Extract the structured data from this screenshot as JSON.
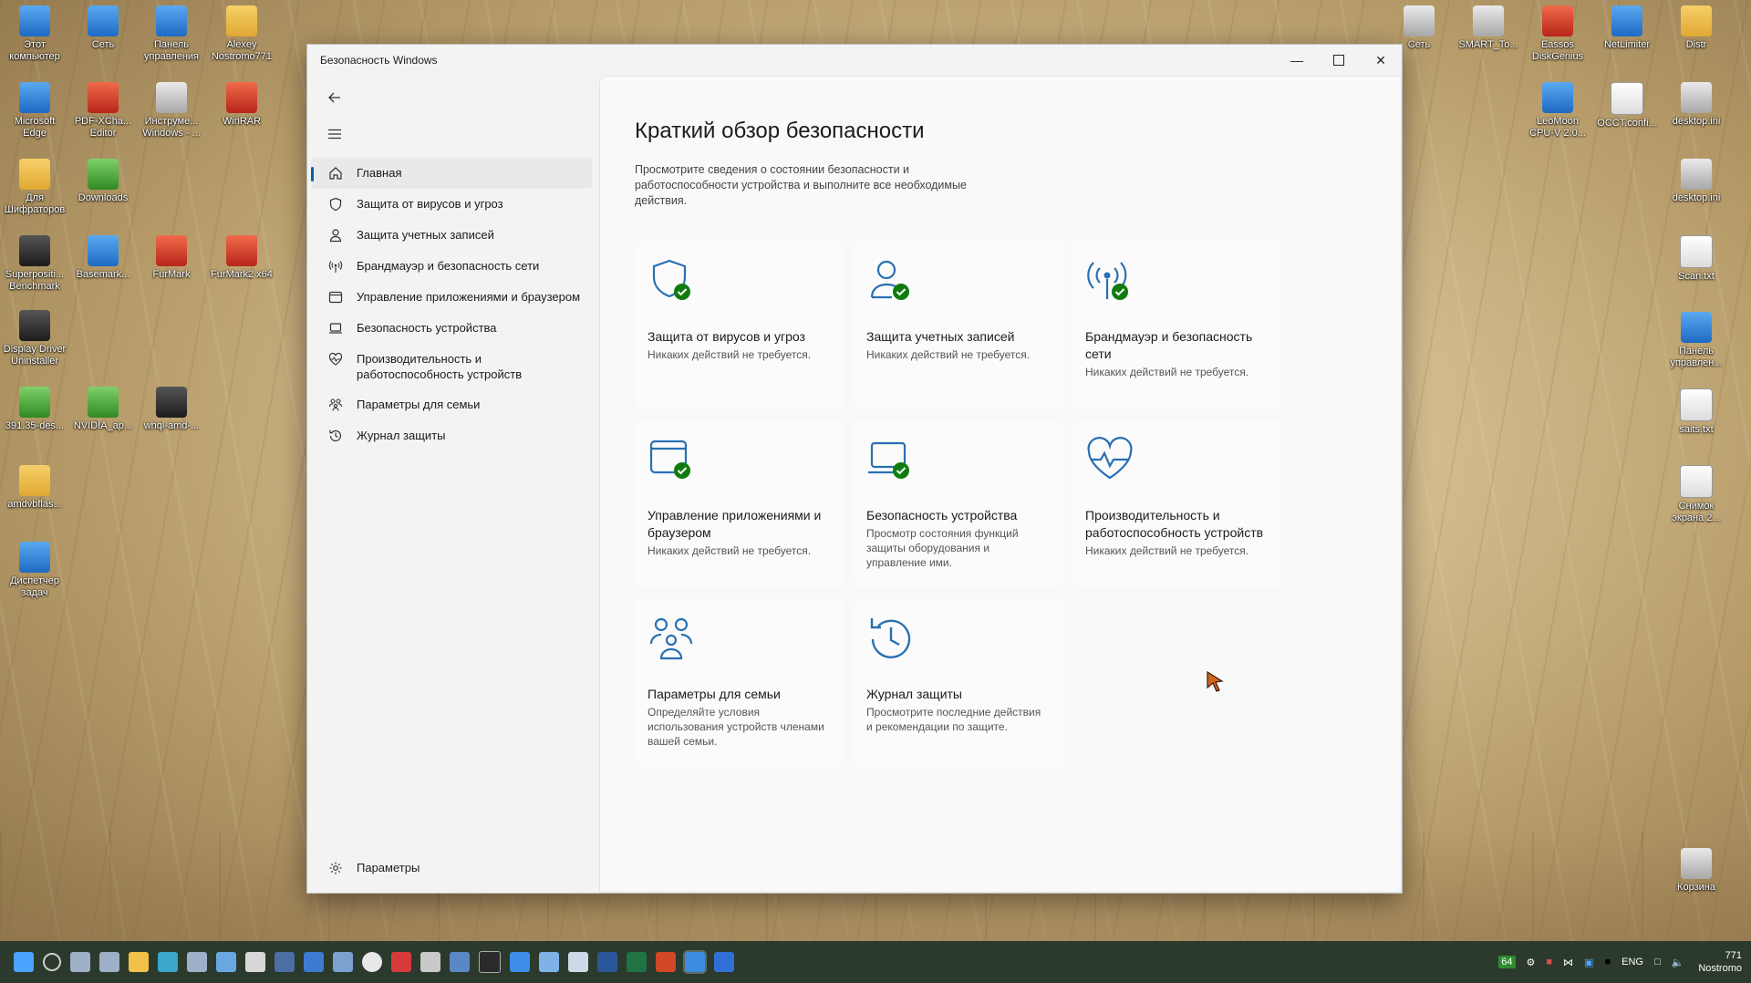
{
  "desktop": {
    "left_icons": [
      {
        "label": "Этот компьютер"
      },
      {
        "label": "Сеть"
      },
      {
        "label": "Панель управления"
      },
      {
        "label": "Alexey Nostromo771"
      },
      {
        "label": "Microsoft Edge"
      },
      {
        "label": "PDF-XCha... Editor"
      },
      {
        "label": "Инструме... Windows - ..."
      },
      {
        "label": "WinRAR"
      },
      {
        "label": "Для Шифраторов"
      },
      {
        "label": "Downloads"
      },
      {
        "label": "Superpositi... Benchmark"
      },
      {
        "label": "Basemark..."
      },
      {
        "label": "FurMark"
      },
      {
        "label": "FurMark2 x64"
      },
      {
        "label": "Display Driver Uninstaller"
      },
      {
        "label": "391.35-des..."
      },
      {
        "label": "NVIDIA_ap..."
      },
      {
        "label": "whql-amd-..."
      },
      {
        "label": "amdvbflas..."
      },
      {
        "label": "Диспетчер задач"
      }
    ],
    "right_icons": [
      {
        "label": "Сеть"
      },
      {
        "label": "SMART_To..."
      },
      {
        "label": "Eassos DiskGenius"
      },
      {
        "label": "NetLimiter"
      },
      {
        "label": "Distr"
      },
      {
        "label": "LeoMoon CPU-V 2.0..."
      },
      {
        "label": "OCCT.confi..."
      },
      {
        "label": "desktop.ini"
      },
      {
        "label": "desktop.ini"
      },
      {
        "label": "Scan.txt"
      },
      {
        "label": "Панель управлен..."
      },
      {
        "label": "saits.txt"
      },
      {
        "label": "Снимок экрана 2..."
      },
      {
        "label": "Корзина"
      }
    ]
  },
  "window": {
    "title": "Безопасность Windows",
    "nav": {
      "items": [
        {
          "label": "Главная",
          "icon": "home-icon"
        },
        {
          "label": "Защита от вирусов и угроз",
          "icon": "shield-icon"
        },
        {
          "label": "Защита учетных записей",
          "icon": "person-icon"
        },
        {
          "label": "Брандмауэр и безопасность сети",
          "icon": "antenna-icon"
        },
        {
          "label": "Управление приложениями и браузером",
          "icon": "app-window-icon"
        },
        {
          "label": "Безопасность устройства",
          "icon": "laptop-icon"
        },
        {
          "label": "Производительность и работоспособность устройств",
          "icon": "heart-icon"
        },
        {
          "label": "Параметры для семьи",
          "icon": "family-icon"
        },
        {
          "label": "Журнал защиты",
          "icon": "history-icon"
        }
      ],
      "settings_label": "Параметры"
    },
    "content": {
      "heading": "Краткий обзор безопасности",
      "subtitle": "Просмотрите сведения о состоянии безопасности и работоспособности устройства и выполните все необходимые действия.",
      "cards": [
        {
          "title": "Защита от вирусов и угроз",
          "desc": "Никаких действий не требуется."
        },
        {
          "title": "Защита учетных записей",
          "desc": "Никаких действий не требуется."
        },
        {
          "title": "Брандмауэр и безопасность сети",
          "desc": "Никаких действий не требуется."
        },
        {
          "title": "Управление приложениями и браузером",
          "desc": "Никаких действий не требуется."
        },
        {
          "title": "Безопасность устройства",
          "desc": "Просмотр состояния функций защиты оборудования и управление ими."
        },
        {
          "title": "Производительность и работоспособность устройств",
          "desc": "Никаких действий не требуется."
        },
        {
          "title": "Параметры для семьи",
          "desc": "Определяйте условия использования устройств членами вашей семьи."
        },
        {
          "title": "Журнал защиты",
          "desc": "Просмотрите последние действия и рекомендации по защите."
        }
      ]
    }
  },
  "taskbar": {
    "tray": {
      "lang": "ENG",
      "badge": "64",
      "clock_line1": "771",
      "clock_line2": "Nostromo"
    }
  },
  "colors": {
    "accent": "#005fb8",
    "icon_blue": "#2a6fb3",
    "check_green": "#107c10"
  }
}
